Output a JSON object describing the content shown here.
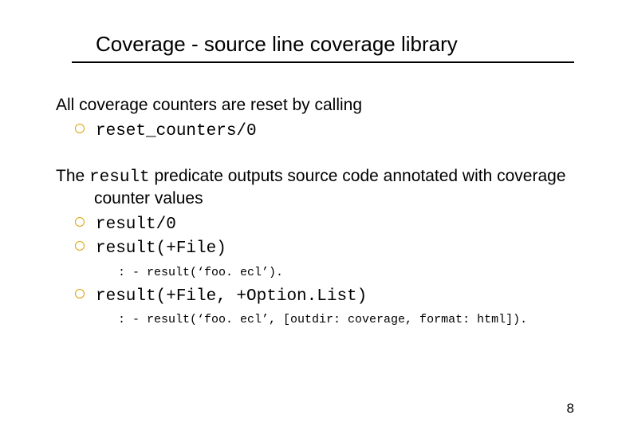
{
  "title": "Coverage - source line coverage library",
  "para1": "All coverage counters are reset by calling",
  "item1": "reset_counters/0",
  "para2_a": "The ",
  "para2_code": "result",
  "para2_b": " predicate outputs source code annotated with coverage counter values",
  "item2": "result/0",
  "item3": "result(+File)",
  "sub1": ": - result(‘foo. ecl’).",
  "item4": "result(+File, +Option.List)",
  "sub2": ": - result(‘foo. ecl’, [outdir: coverage, format: html]).",
  "pageNumber": "8"
}
